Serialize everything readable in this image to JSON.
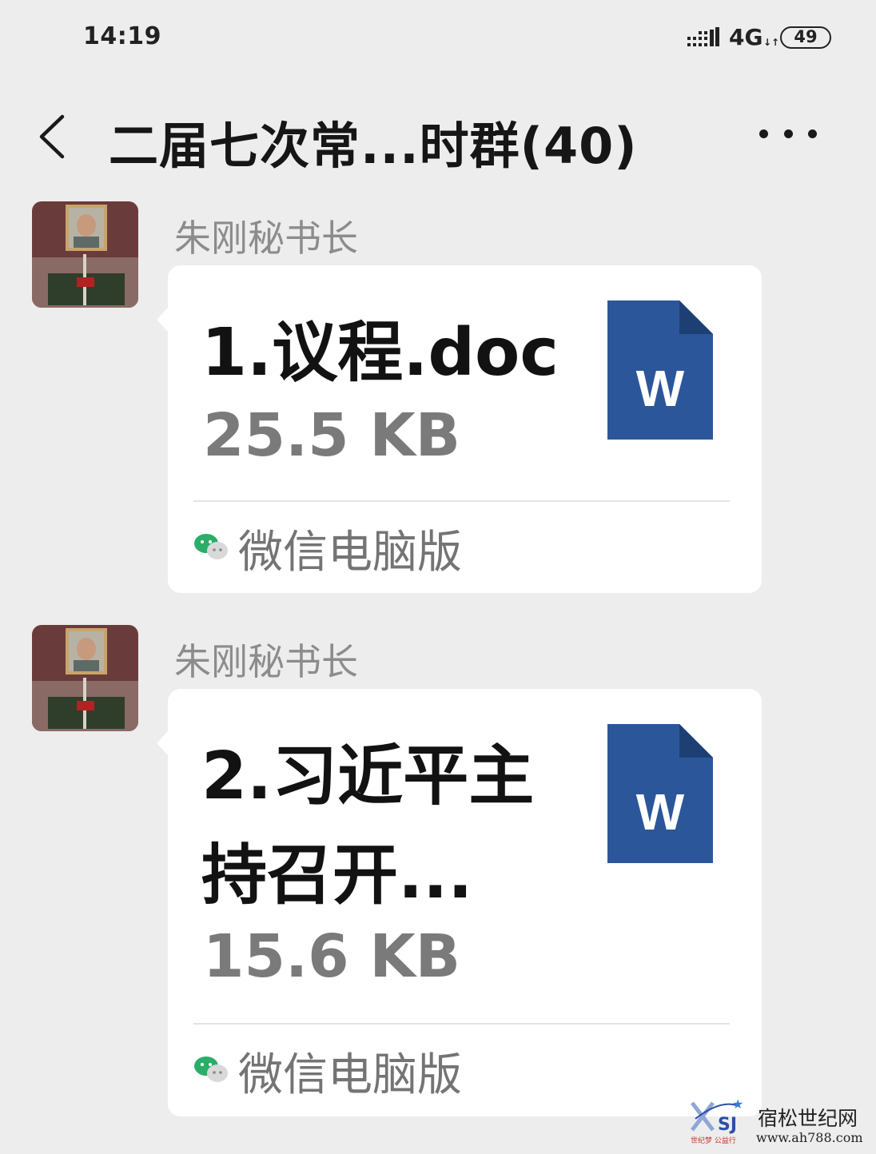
{
  "status_bar": {
    "time": "14:19",
    "network": "4G",
    "battery": "49"
  },
  "header": {
    "title": "二届七次常...时群(40)"
  },
  "messages": [
    {
      "sender": "朱刚秘书长",
      "file_name": "1.议程.doc",
      "file_size": "25.5 KB",
      "source": "微信电脑版",
      "icon_letter": "W"
    },
    {
      "sender": "朱刚秘书长",
      "file_name": "2.习近平主持召开...",
      "file_size": "15.6 KB",
      "source": "微信电脑版",
      "icon_letter": "W"
    }
  ],
  "watermark": {
    "site_name": "宿松世纪网",
    "url": "www.ah788.com",
    "tagline": "世纪梦 公益行",
    "logo_text": "SJ"
  },
  "colors": {
    "background": "#ededed",
    "bubble": "#ffffff",
    "word_blue": "#2b579a",
    "wechat_green": "#2aae67"
  }
}
